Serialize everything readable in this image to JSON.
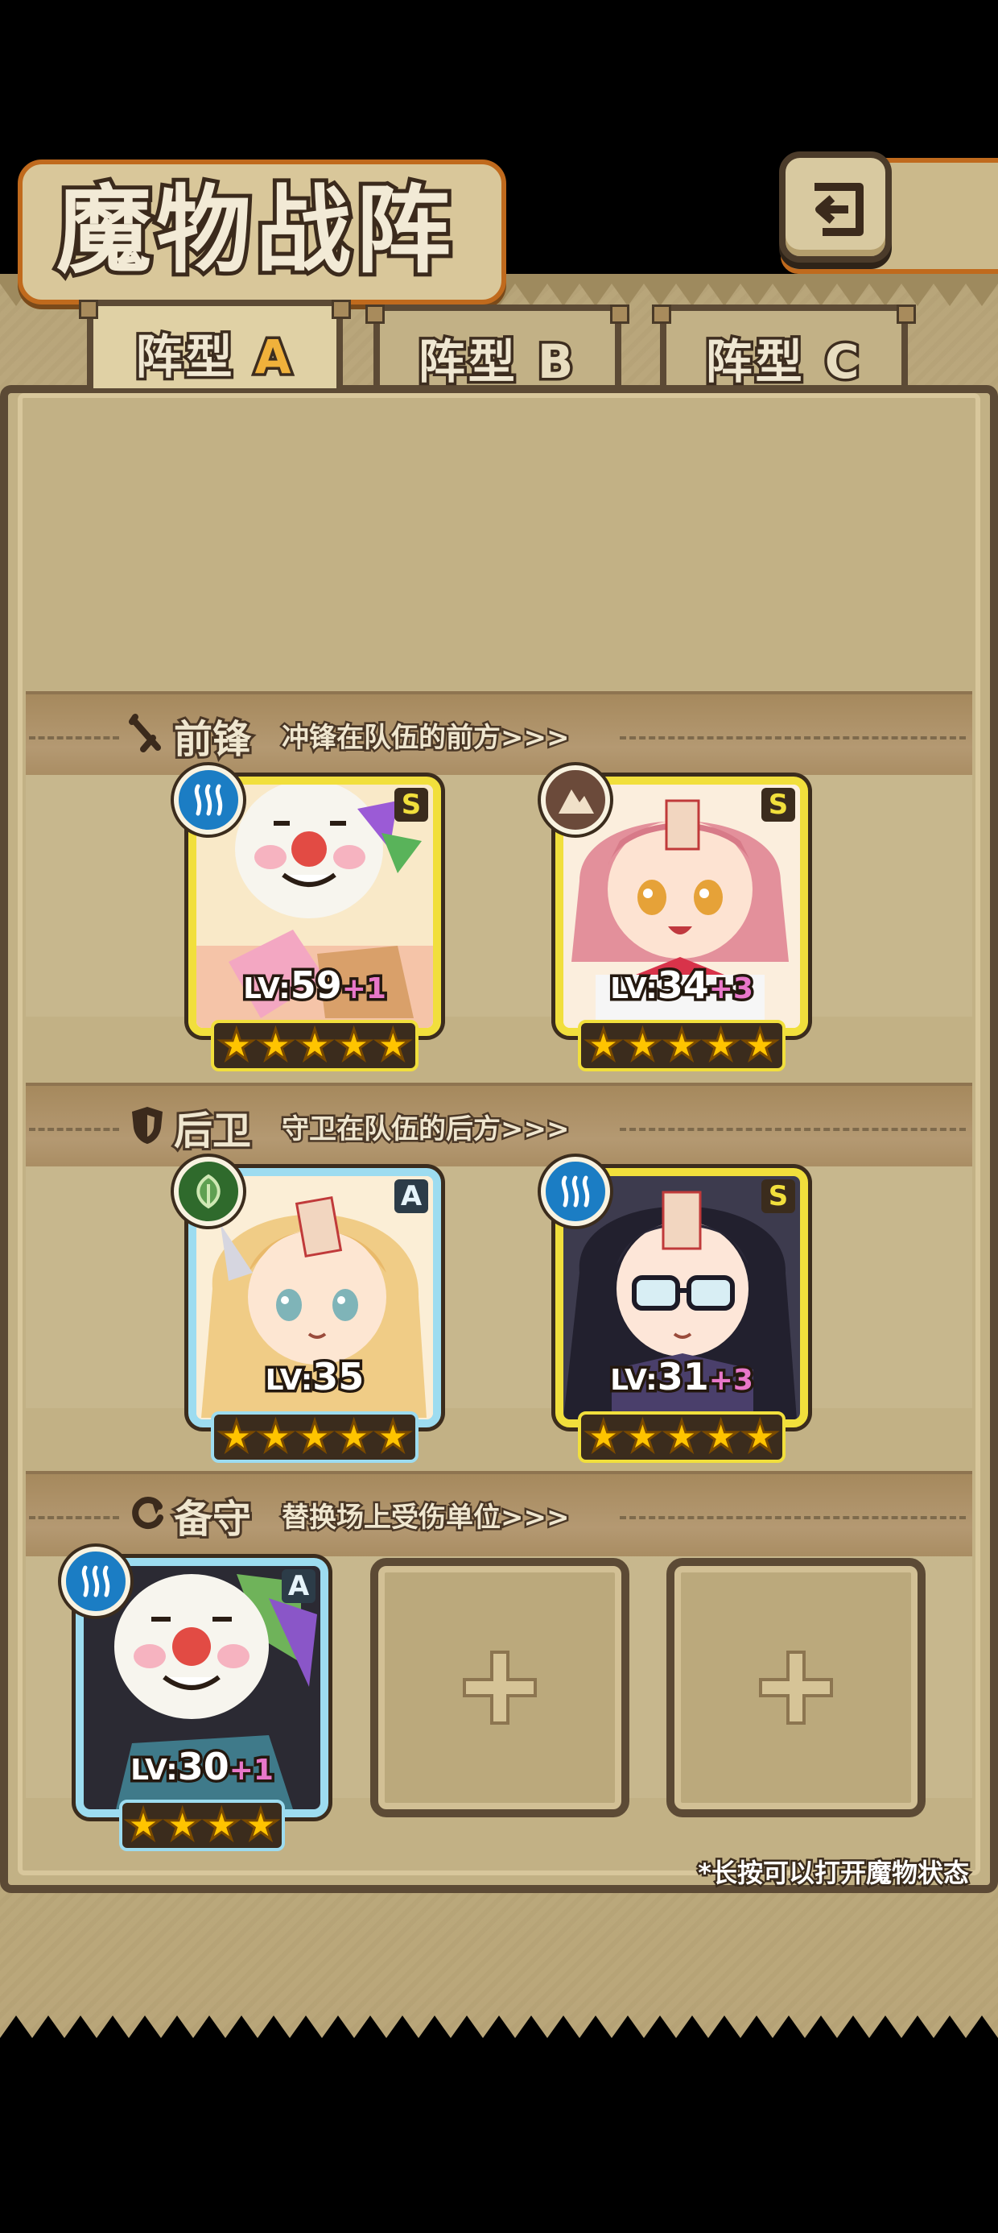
{
  "header": {
    "title": "魔物战阵"
  },
  "tabs": [
    {
      "prefix": "阵型",
      "suffix": "A",
      "active": true
    },
    {
      "prefix": "阵型",
      "suffix": "B",
      "active": false
    },
    {
      "prefix": "阵型",
      "suffix": "C",
      "active": false
    }
  ],
  "sections": {
    "front": {
      "title": "前锋",
      "subtitle": "冲锋在队伍的前方>>>"
    },
    "back": {
      "title": "后卫",
      "subtitle": "守卫在队伍的后方>>>"
    },
    "reserve": {
      "title": "备守",
      "subtitle": "替换场上受伤单位>>>"
    }
  },
  "units": {
    "front_1": {
      "rank": "S",
      "element": "water",
      "lv_tag": "LV:",
      "level": "59",
      "bonus": "+1",
      "stars": 5
    },
    "front_2": {
      "rank": "S",
      "element": "earth",
      "lv_tag": "LV:",
      "level": "34",
      "bonus": "+3",
      "stars": 5
    },
    "back_1": {
      "rank": "A",
      "element": "grass",
      "lv_tag": "LV:",
      "level": "35",
      "bonus": "",
      "stars": 5
    },
    "back_2": {
      "rank": "S",
      "element": "water",
      "lv_tag": "LV:",
      "level": "31",
      "bonus": "+3",
      "stars": 5
    },
    "reserve_1": {
      "rank": "A",
      "element": "water",
      "lv_tag": "LV:",
      "level": "30",
      "bonus": "+1",
      "stars": 4
    }
  },
  "footnote": "*长按可以打开魔物状态",
  "icons": {
    "back": "return-arrow-icon",
    "front_section": "sword-icon",
    "back_section": "shield-icon",
    "reserve_section": "refresh-icon",
    "empty_slot": "plus-icon",
    "rank_star": "star-icon"
  },
  "colors": {
    "rank_S_frame": "#f1df3c",
    "rank_A_frame": "#9ddcf0",
    "tab_active_letter": "#f0b13b",
    "bonus": "#e877c9",
    "water": "#1b7dc4",
    "earth": "#6b4a3a",
    "grass": "#2f6a2c"
  }
}
